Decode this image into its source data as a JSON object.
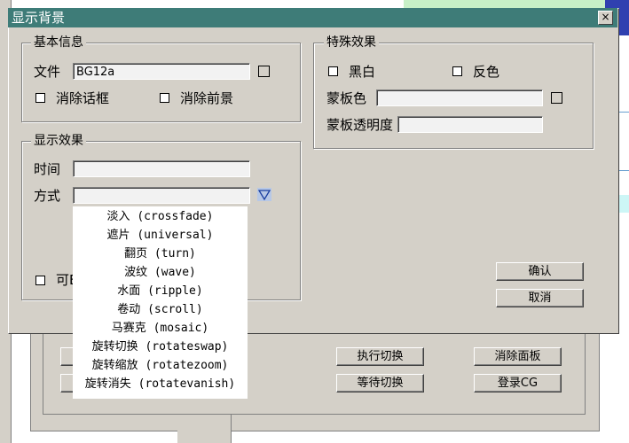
{
  "dialog": {
    "title": "显示背景",
    "close_label": "×"
  },
  "basic_info": {
    "legend": "基本信息",
    "file_label": "文件",
    "file_value": "BG12a",
    "hide_dialog_label": "消除话框",
    "hide_foreground_label": "消除前景"
  },
  "display_effect": {
    "legend": "显示效果",
    "time_label": "时间",
    "time_value": "",
    "mode_label": "方式",
    "mode_value": "",
    "partial_label": "可E"
  },
  "special_effect": {
    "legend": "特殊效果",
    "black_white_label": "黑白",
    "invert_label": "反色",
    "mask_color_label": "蒙板色",
    "mask_color_value": "",
    "mask_opacity_label": "蒙板透明度",
    "mask_opacity_value": ""
  },
  "buttons": {
    "confirm": "确认",
    "cancel": "取消"
  },
  "mode_options": [
    "淡入 (crossfade)",
    "遮片 (universal)",
    "翻页 (turn)",
    "波纹 (wave)",
    "水面 (ripple)",
    "卷动 (scroll)",
    "马赛克 (mosaic)",
    "旋转切换 (rotateswap)",
    "旋转缩放 (rotatezoom)",
    "旋转消失 (rotatevanish)"
  ],
  "background_window": {
    "execute_switch": "执行切换",
    "wait_switch": "等待切换",
    "remove_panel": "消除面板",
    "register_cg": "登录CG"
  },
  "colors": {
    "titlebar": "#3e7c78",
    "face": "#d4d0c8",
    "dropdown_arrow": "#b7c8e6"
  }
}
